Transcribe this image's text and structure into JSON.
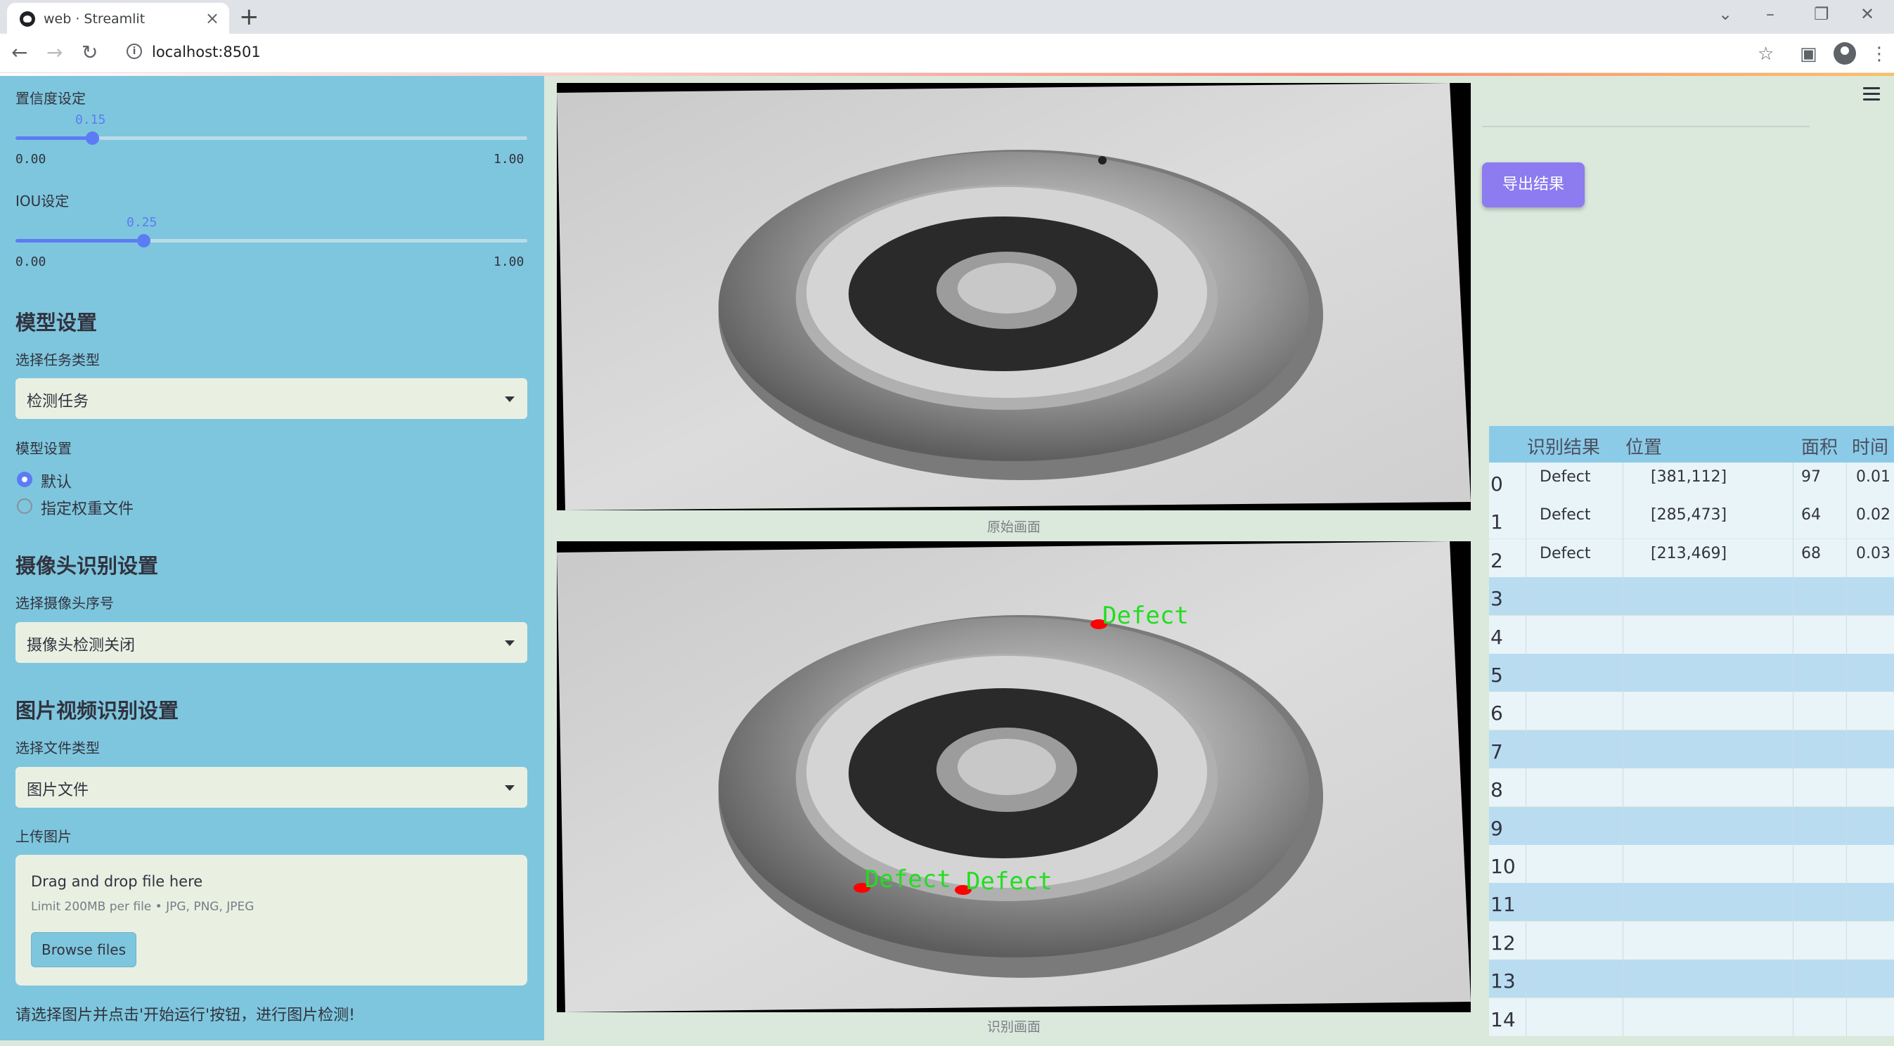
{
  "browser": {
    "tab_title": "web · Streamlit",
    "url": "localhost:8501"
  },
  "sidebar": {
    "confidence": {
      "label": "置信度设定",
      "value": "0.15",
      "min": "0.00",
      "max": "1.00",
      "fraction": 0.15
    },
    "iou": {
      "label": "IOU设定",
      "value": "0.25",
      "min": "0.00",
      "max": "1.00",
      "fraction": 0.25
    },
    "model_section": {
      "title": "模型设置",
      "task_label": "选择任务类型",
      "task_value": "检测任务",
      "model_label": "模型设置",
      "radio_default": "默认",
      "radio_custom": "指定权重文件",
      "selected": "默认"
    },
    "camera_section": {
      "title": "摄像头识别设置",
      "camera_label": "选择摄像头序号",
      "camera_value": "摄像头检测关闭"
    },
    "media_section": {
      "title": "图片视频识别设置",
      "file_type_label": "选择文件类型",
      "file_type_value": "图片文件",
      "upload_label": "上传图片",
      "drop_text": "Drag and drop file here",
      "limit_text": "Limit 200MB per file • JPG, PNG, JPEG",
      "browse_label": "Browse files"
    },
    "hint": "请选择图片并点击'开始运行'按钮，进行图片检测!"
  },
  "main": {
    "original_caption": "原始画面",
    "result_caption": "识别画面",
    "detections": [
      {
        "label": "Defect"
      },
      {
        "label": "Defect"
      },
      {
        "label": "Defect"
      }
    ]
  },
  "right": {
    "export_label": "导出结果",
    "table": {
      "headers": [
        "识别结果",
        "位置",
        "面积",
        "时间"
      ],
      "rows": [
        {
          "idx": "0",
          "result": "Defect",
          "pos": "[381,112]",
          "area": "97",
          "time": "0.01"
        },
        {
          "idx": "1",
          "result": "Defect",
          "pos": "[285,473]",
          "area": "64",
          "time": "0.02"
        },
        {
          "idx": "2",
          "result": "Defect",
          "pos": "[213,469]",
          "area": "68",
          "time": "0.03"
        },
        {
          "idx": "3"
        },
        {
          "idx": "4"
        },
        {
          "idx": "5"
        },
        {
          "idx": "6"
        },
        {
          "idx": "7"
        },
        {
          "idx": "8"
        },
        {
          "idx": "9"
        },
        {
          "idx": "10"
        },
        {
          "idx": "11"
        },
        {
          "idx": "12"
        },
        {
          "idx": "13"
        },
        {
          "idx": "14"
        }
      ]
    }
  },
  "colors": {
    "sidebar": "#7ec6dd",
    "accent": "#5b7cf5",
    "export_button": "#8c7cf0",
    "detection_box": "#ff0000",
    "detection_text": "#22dd22"
  }
}
